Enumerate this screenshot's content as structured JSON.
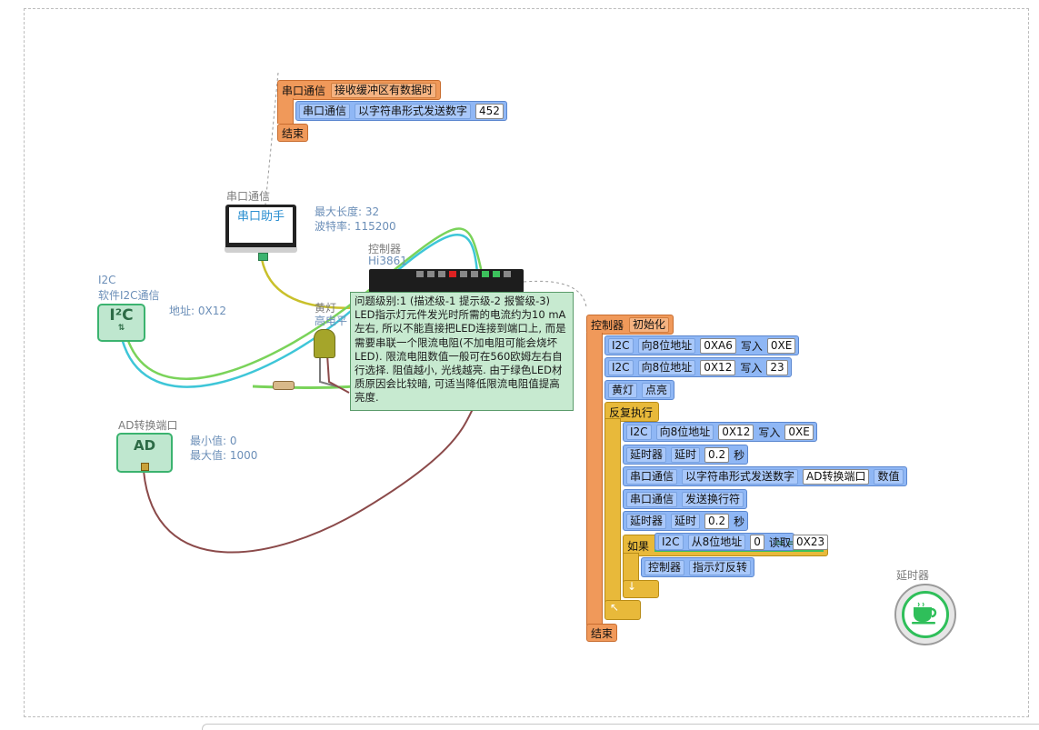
{
  "colors": {
    "hat": "#f0995a",
    "block": "#8fb7f5",
    "loop": "#e8b93a",
    "device": "#bfe7cf",
    "tooltip": "#c7ead0"
  },
  "serial_event": {
    "hat_label": "串口通信",
    "hat_event": "接收缓冲区有数据时",
    "send_obj": "串口通信",
    "send_action": "以字符串形式发送数字",
    "send_value": "452",
    "end": "结束"
  },
  "devices": {
    "serial": {
      "title": "串口通信",
      "screen": "串口助手",
      "prop1": "最大长度: 32",
      "prop2": "波特率: 115200",
      "icon": "monitor-icon"
    },
    "i2c": {
      "title": "I2C",
      "subtitle": "软件I2C通信",
      "glyph": "I²C",
      "addr": "地址: 0X12",
      "icon": "i2c-icon"
    },
    "ad": {
      "title": "AD转换端口",
      "glyph": "AD",
      "min": "最小值: 0",
      "max": "最大值: 1000"
    },
    "controller": {
      "title": "控制器",
      "model": "Hi3861"
    },
    "led": {
      "title": "黄灯",
      "level": "高电平"
    },
    "timer": {
      "title": "延时器",
      "icon": "teacup-icon"
    }
  },
  "tooltip": "问题级别:1 (描述级-1 提示级-2 报警级-3) LED指示灯元件发光时所需的电流约为10 mA左右, 所以不能直接把LED连接到端口上, 而是需要串联一个限流电阻(不加电阻可能会烧坏LED). 限流电阻数值一般可在560欧姆左右自行选择. 阻值越小, 光线越亮. 由于绿色LED材质原因会比较暗, 可适当降低限流电阻值提高亮度.",
  "main_program": {
    "hat_obj": "控制器",
    "hat_event": "初始化",
    "i2c1_obj": "I2C",
    "i2c1_action": "向8位地址",
    "i2c1_addr": "0XA6",
    "i2c1_write": "写入",
    "i2c1_val": "0XE",
    "i2c2_obj": "I2C",
    "i2c2_action": "向8位地址",
    "i2c2_addr": "0X12",
    "i2c2_write": "写入",
    "i2c2_val": "23",
    "led_obj": "黄灯",
    "led_action": "点亮",
    "loop_label": "反复执行",
    "l1_obj": "I2C",
    "l1_action": "向8位地址",
    "l1_addr": "0X12",
    "l1_write": "写入",
    "l1_val": "0XE",
    "l2_obj": "延时器",
    "l2_action": "延时",
    "l2_val": "0.2",
    "l2_unit": "秒",
    "l3_obj": "串口通信",
    "l3_action": "以字符串形式发送数字",
    "l3_src_obj": "AD转换端口",
    "l3_src_prop": "数值",
    "l4_obj": "串口通信",
    "l4_action": "发送换行符",
    "l5_obj": "延时器",
    "l5_action": "延时",
    "l5_val": "0.2",
    "l5_unit": "秒",
    "if_label": "如果",
    "if_obj": "I2C",
    "if_action": "从8位地址",
    "if_addr": "0",
    "if_read": "读取",
    "if_op": "= =",
    "if_val": "0X23",
    "then_obj": "控制器",
    "then_action": "指示灯反转",
    "end": "结束"
  }
}
